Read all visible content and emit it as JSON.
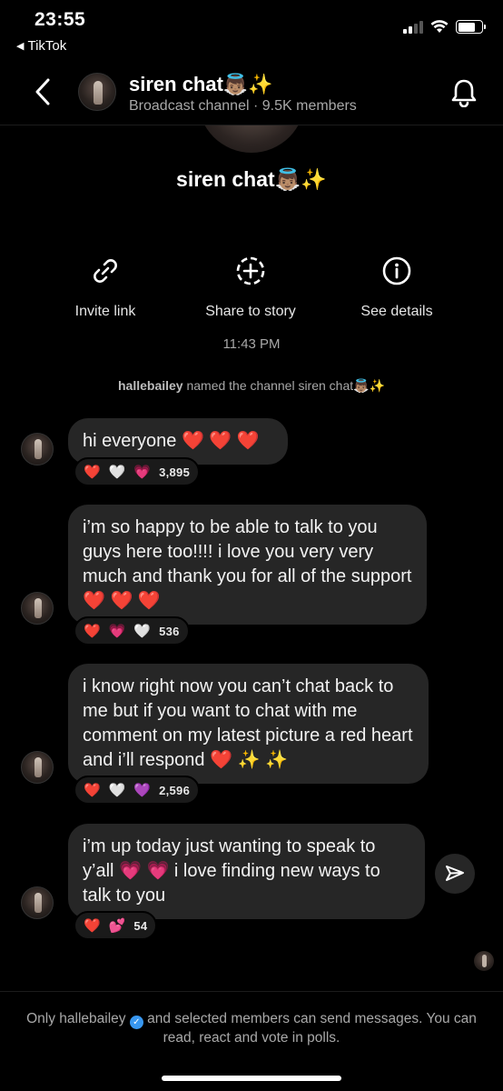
{
  "status": {
    "time": "23:55",
    "back_app": "TikTok"
  },
  "header": {
    "channel_name": "siren chat👼🏽✨",
    "subtitle": "Broadcast channel · 9.5K members"
  },
  "profile": {
    "name": "siren chat👼🏽✨"
  },
  "actions": [
    {
      "label": "Invite link",
      "icon": "link-icon"
    },
    {
      "label": "Share to story",
      "icon": "add-story-icon"
    },
    {
      "label": "See details",
      "icon": "info-icon"
    }
  ],
  "timestamp": "11:43 PM",
  "system_message": {
    "user": "hallebailey",
    "text": " named the channel siren chat👼🏽✨"
  },
  "messages": [
    {
      "text": "hi everyone ❤️ ❤️ ❤️",
      "reactions": [
        "❤️",
        "🤍",
        "💗"
      ],
      "count": "3,895"
    },
    {
      "text": "i’m so happy to be able to talk to you guys here too!!!! i love you very very much and thank you for all of the support ❤️ ❤️ ❤️",
      "reactions": [
        "❤️",
        "💗",
        "🤍"
      ],
      "count": "536"
    },
    {
      "text": "i know right now you can’t chat back to me but if you want to chat with me comment on my latest picture a red heart and i’ll respond ❤️ ✨ ✨",
      "reactions": [
        "❤️",
        "🤍",
        "💜"
      ],
      "count": "2,596"
    },
    {
      "text": "i’m up today just wanting to speak to y’all 💗 💗 i love finding new ways to talk to you",
      "reactions": [
        "❤️",
        "💕"
      ],
      "count": "54"
    }
  ],
  "footer": {
    "pre": "Only hallebailey",
    "post": " and selected members can send messages. You can read, react and vote in polls."
  }
}
